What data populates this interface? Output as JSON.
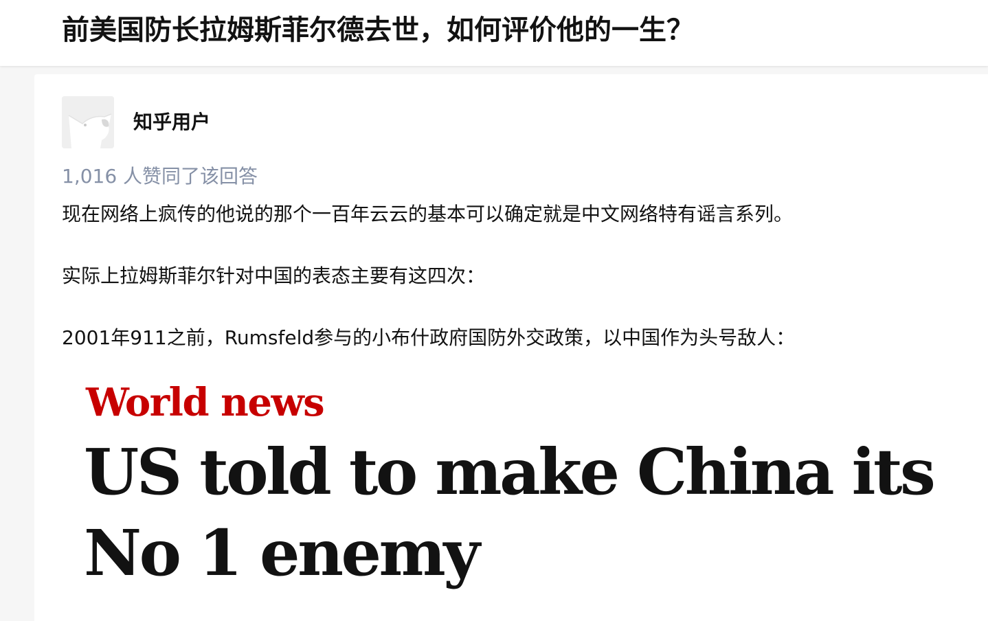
{
  "question": {
    "title": "前美国防长拉姆斯菲尔德去世，如何评价他的一生？"
  },
  "answer": {
    "author": {
      "name": "知乎用户",
      "avatar_icon": "default-avatar-icon"
    },
    "vote_text": "1,016 人赞同了该回答",
    "paragraphs": [
      "现在网络上疯传的他说的那个一百年云云的基本可以确定就是中文网络特有谣言系列。",
      "实际上拉姆斯菲尔针对中国的表态主要有这四次：",
      "2001年911之前，Rumsfeld参与的小布什政府国防外交政策，以中国作为头号敌人："
    ],
    "embedded_image": {
      "section": "World news",
      "headline": "US told to make China its No 1 enemy"
    }
  },
  "colors": {
    "page_background": "#f6f6f6",
    "card_background": "#ffffff",
    "title_text": "#121212",
    "meta_gray": "#8590a6",
    "news_red": "#c70000"
  }
}
